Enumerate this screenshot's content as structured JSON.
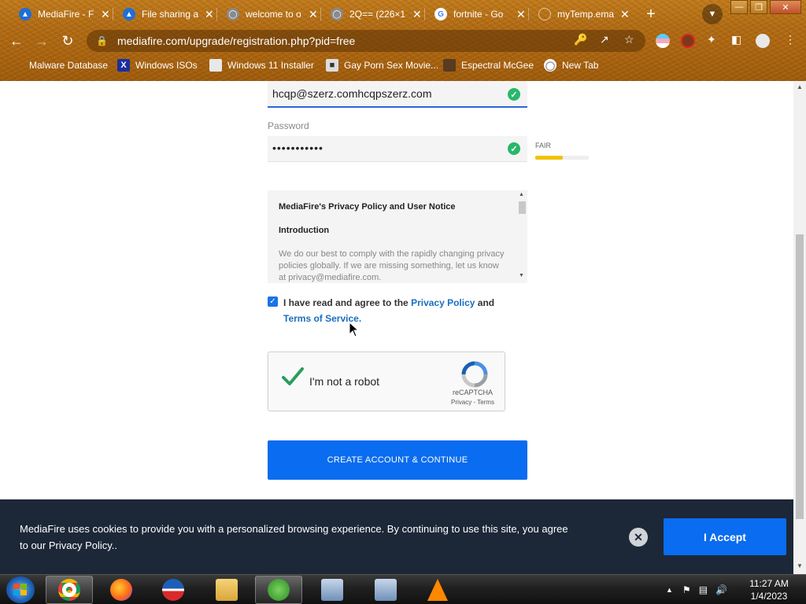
{
  "browser": {
    "tabs": [
      {
        "title": "MediaFire - F",
        "favicon": "mediafire-icon"
      },
      {
        "title": "File sharing a",
        "favicon": "mediafire-icon"
      },
      {
        "title": "welcome to o",
        "favicon": "globe-icon"
      },
      {
        "title": "2Q== (226×1",
        "favicon": "globe-icon"
      },
      {
        "title": "fortnite - Go",
        "favicon": "google-icon"
      },
      {
        "title": "myTemp.ema",
        "favicon": "blank-icon"
      }
    ],
    "tab_close": "✕",
    "new_tab": "+",
    "window_controls": {
      "minimize": "—",
      "restore": "❐",
      "close": "✕"
    },
    "url": "mediafire.com/upgrade/registration.php?pid=free",
    "bookmarks": [
      {
        "label": "Malware Database"
      },
      {
        "label": "Windows ISOs"
      },
      {
        "label": "Windows 11 Installer"
      },
      {
        "label": "Gay Porn Sex Movie..."
      },
      {
        "label": "Espectral McGee"
      },
      {
        "label": "New Tab"
      }
    ]
  },
  "form": {
    "email_value": "hcqp@szerz.comhcqpszerz.com",
    "password_label": "Password",
    "password_value": "•••••••••••",
    "strength_label": "FAIR",
    "strength_level": 0.52
  },
  "policy": {
    "title": "MediaFire's Privacy Policy and User Notice",
    "intro": "Introduction",
    "body": "We do our best to comply with the rapidly changing privacy policies globally. If we are missing something, let us know at privacy@mediafire.com."
  },
  "agree": {
    "prefix": "I have read and agree to the ",
    "privacy_link": "Privacy Policy",
    "middle": " and ",
    "terms_link": "Terms of Service."
  },
  "captcha": {
    "label": "I'm not a robot",
    "brand": "reCAPTCHA",
    "terms": "Privacy - Terms"
  },
  "create_button": "CREATE ACCOUNT & CONTINUE",
  "cookie": {
    "message": "MediaFire uses cookies to provide you with a personalized browsing experience. By continuing to use this site, you agree to our Privacy Policy..",
    "accept": "I Accept",
    "close": "✕"
  },
  "taskbar": {
    "time": "11:27 AM",
    "date": "1/4/2023"
  },
  "colors": {
    "accent": "#0a6cf0",
    "success": "#27b86a",
    "strength_fair": "#f2c200",
    "cookie_bg": "#1c2838"
  }
}
